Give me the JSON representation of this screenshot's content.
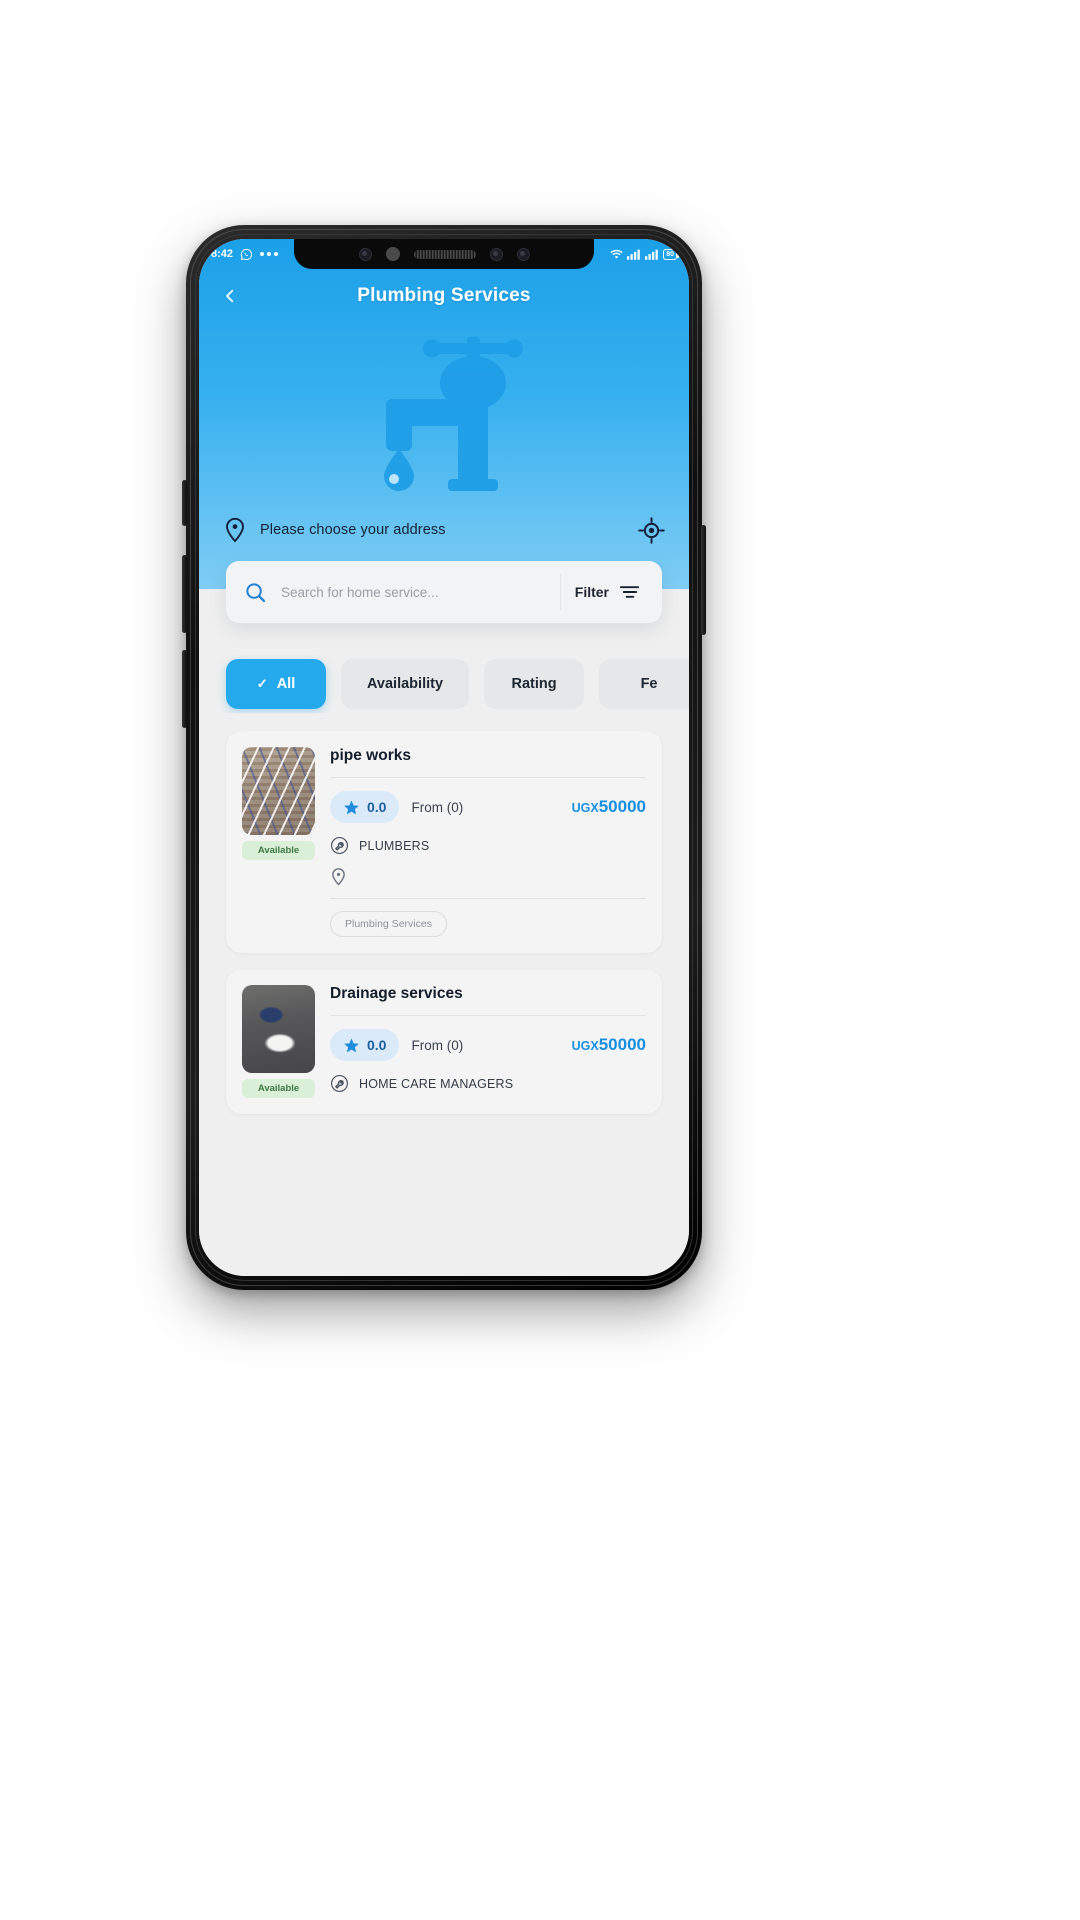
{
  "status_bar": {
    "time": "8:42",
    "whatsapp_icon": "whatsapp-icon",
    "more_dots": "more-notifications-dots",
    "wifi_icon": "wifi-icon",
    "signal_icon": "signal-bars-icon",
    "signal_icon_2": "signal-bars-icon",
    "battery_level": "80"
  },
  "header": {
    "back_icon": "chevron-left-icon",
    "title": "Plumbing Services",
    "illustration": "faucet-icon",
    "location_pin_icon": "location-pin-icon",
    "address_placeholder": "Please choose your address",
    "gps_icon": "gps-target-icon"
  },
  "search": {
    "search_icon": "search-icon",
    "value": "",
    "placeholder": "Search for home service...",
    "filter_label": "Filter",
    "filter_icon": "filter-lines-icon"
  },
  "chips": [
    {
      "label": "All",
      "active": true,
      "tick": "✓"
    },
    {
      "label": "Availability",
      "active": false,
      "tick": ""
    },
    {
      "label": "Rating",
      "active": false,
      "tick": ""
    },
    {
      "label": "Fe",
      "active": false,
      "tick": ""
    }
  ],
  "cards": [
    {
      "title": "pipe works",
      "thumb": "pipe-works-photo",
      "availability": "Available",
      "rating": "0.0",
      "star_icon": "star-icon",
      "reviews": "From (0)",
      "currency": "UGX",
      "price": "50000",
      "category_icon": "wrench-icon",
      "category": "PLUMBERS",
      "location_icon": "location-pin-icon",
      "location": "",
      "tag": "Plumbing Services"
    },
    {
      "title": "Drainage services",
      "thumb": "drainage-photo",
      "availability": "Available",
      "rating": "0.0",
      "star_icon": "star-icon",
      "reviews": "From (0)",
      "currency": "UGX",
      "price": "50000",
      "category_icon": "wrench-icon",
      "category": "HOME CARE MANAGERS",
      "location_icon": "location-pin-icon",
      "location": "",
      "tag": ""
    }
  ],
  "colors": {
    "brand_blue": "#24a9ec",
    "hero_top": "#1ba0e8",
    "hero_bottom": "#7fcdf4",
    "price_blue": "#178fe0",
    "available_green": "#3e7a44",
    "body_bg": "#efefef"
  }
}
